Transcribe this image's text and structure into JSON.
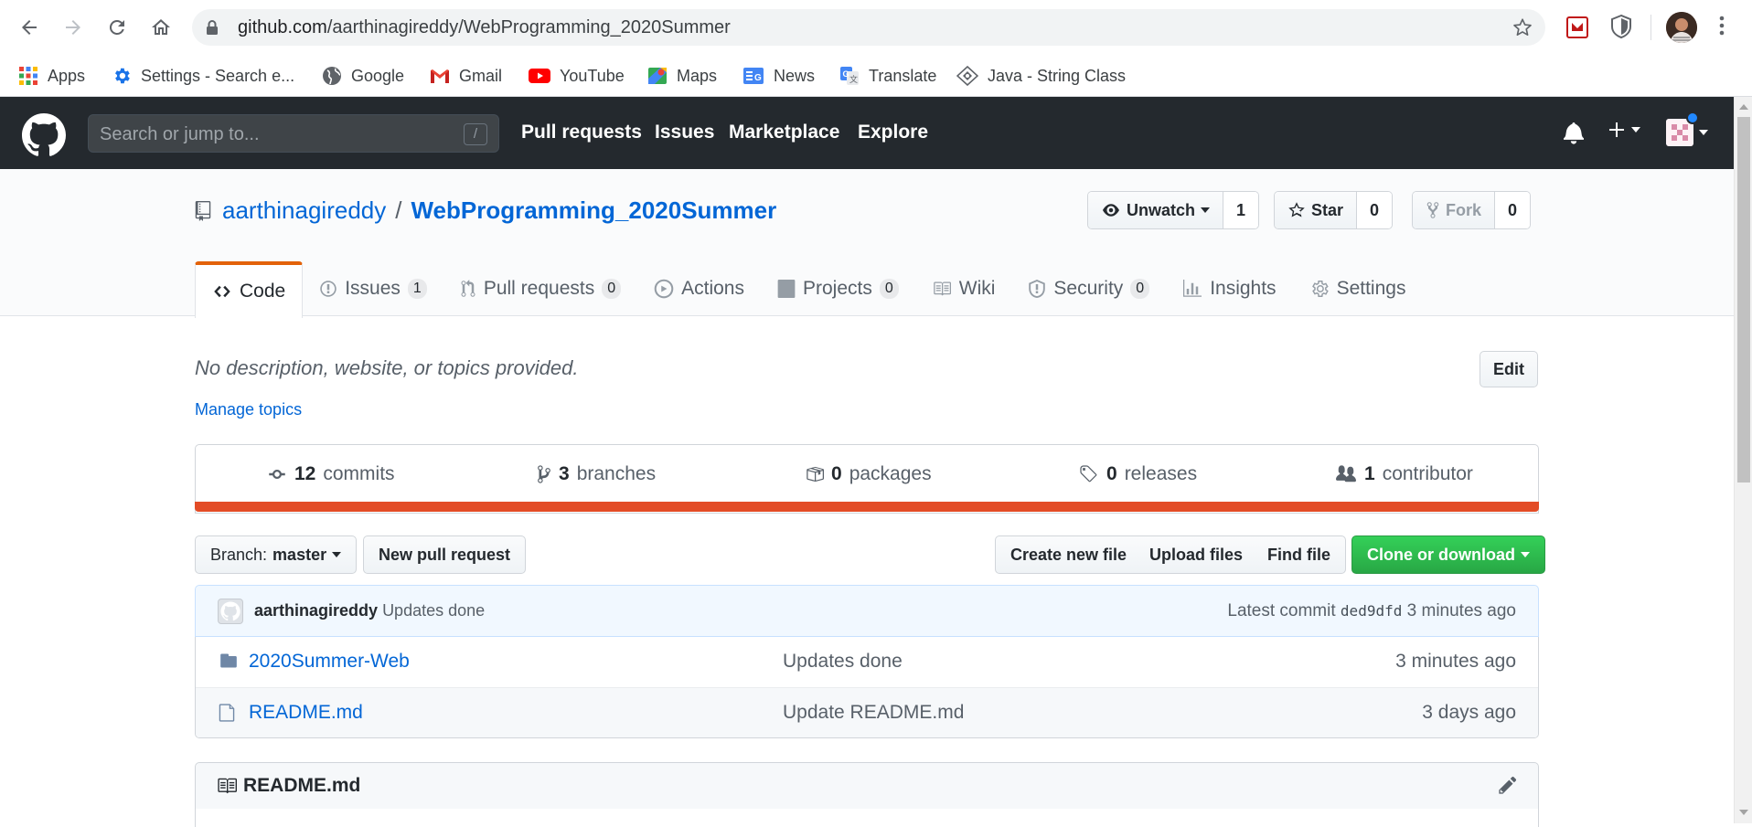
{
  "browser": {
    "url_host": "github.com",
    "url_path": "/aarthinagireddy/WebProgramming_2020Summer",
    "bookmarks": [
      {
        "label": "Apps",
        "icon": "apps-grid-icon"
      },
      {
        "label": "Settings - Search e...",
        "icon": "gear-icon"
      },
      {
        "label": "Google",
        "icon": "globe-icon"
      },
      {
        "label": "Gmail",
        "icon": "gmail-icon"
      },
      {
        "label": "YouTube",
        "icon": "youtube-icon"
      },
      {
        "label": "Maps",
        "icon": "maps-icon"
      },
      {
        "label": "News",
        "icon": "news-icon"
      },
      {
        "label": "Translate",
        "icon": "translate-icon"
      },
      {
        "label": "Java - String Class",
        "icon": "java-icon"
      }
    ]
  },
  "github": {
    "search_placeholder": "Search or jump to...",
    "search_shortcut": "/",
    "nav": [
      "Pull requests",
      "Issues",
      "Marketplace",
      "Explore"
    ]
  },
  "repo": {
    "owner": "aarthinagireddy",
    "separator": "/",
    "name": "WebProgramming_2020Summer",
    "watch": {
      "label": "Unwatch",
      "count": "1"
    },
    "star": {
      "label": "Star",
      "count": "0"
    },
    "fork": {
      "label": "Fork",
      "count": "0"
    },
    "tabs": [
      {
        "label": "Code",
        "icon": "code-icon",
        "selected": true
      },
      {
        "label": "Issues",
        "count": "1",
        "icon": "issue-icon"
      },
      {
        "label": "Pull requests",
        "count": "0",
        "icon": "pull-request-icon"
      },
      {
        "label": "Actions",
        "icon": "play-icon"
      },
      {
        "label": "Projects",
        "count": "0",
        "icon": "project-icon"
      },
      {
        "label": "Wiki",
        "icon": "book-icon"
      },
      {
        "label": "Security",
        "count": "0",
        "icon": "shield-icon"
      },
      {
        "label": "Insights",
        "icon": "graph-icon"
      },
      {
        "label": "Settings",
        "icon": "gear-icon"
      }
    ],
    "description": "No description, website, or topics provided.",
    "manage_topics": "Manage topics",
    "edit_label": "Edit",
    "summary": [
      {
        "num": "12",
        "label": "commits"
      },
      {
        "num": "3",
        "label": "branches"
      },
      {
        "num": "0",
        "label": "packages"
      },
      {
        "num": "0",
        "label": "releases"
      },
      {
        "num": "1",
        "label": "contributor"
      }
    ],
    "language_color": "#e34c26",
    "branch_prefix": "Branch:",
    "branch": "master",
    "new_pr": "New pull request",
    "create_file": "Create new file",
    "upload_files": "Upload files",
    "find_file": "Find file",
    "clone": "Clone or download",
    "commit": {
      "author": "aarthinagireddy",
      "message": "Updates done",
      "latest_label": "Latest commit",
      "sha": "ded9dfd",
      "age": "3 minutes ago"
    },
    "files": [
      {
        "name": "2020Summer-Web",
        "type": "folder",
        "message": "Updates done",
        "age": "3 minutes ago"
      },
      {
        "name": "README.md",
        "type": "file",
        "message": "Update README.md",
        "age": "3 days ago"
      }
    ],
    "readme_title": "README.md"
  }
}
